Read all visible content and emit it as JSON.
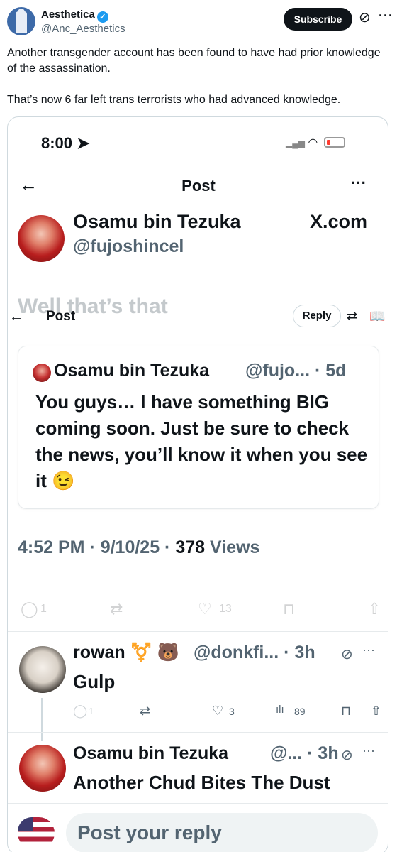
{
  "author": {
    "name": "Aesthetica",
    "handle": "@Anc_Aesthetics",
    "subscribe_label": "Subscribe"
  },
  "tweet": {
    "line1": "Another transgender account has been found to have had prior knowledge of the assassination.",
    "line2": "That’s now 6 far left trans terrorists who had advanced knowledge."
  },
  "screenshot": {
    "status_time": "8:00",
    "header_title": "Post",
    "profile_name": "Osamu bin Tezuka",
    "profile_handle": "@fujoshincel",
    "site_label": "X.com",
    "ghost_text": "Well that’s that",
    "inner_header_title": "Post",
    "inner_reply_label": "Reply",
    "quote": {
      "name": "Osamu bin Tezuka",
      "meta": "@fujo... · 5d",
      "text": "You guys… I have something BIG coming soon. Just be sure to check the news, you’ll know it when you see it 😉"
    },
    "timestamp": "4:52 PM · 9/10/25 · ",
    "views_count": "378",
    "views_label": " Views",
    "faded_counts": {
      "replies": "1",
      "likes": "13"
    },
    "reply": {
      "name": "rowan ⚧️ 🐻",
      "meta": "@donkfi... · 3h",
      "text": "Gulp",
      "replies": "1",
      "likes": "3",
      "views": "89"
    },
    "bottom_reply": {
      "name": "Osamu bin Tezuka",
      "meta": "@... · 3h",
      "text": "Another Chud Bites The Dust"
    },
    "reply_placeholder": "Post your reply"
  }
}
